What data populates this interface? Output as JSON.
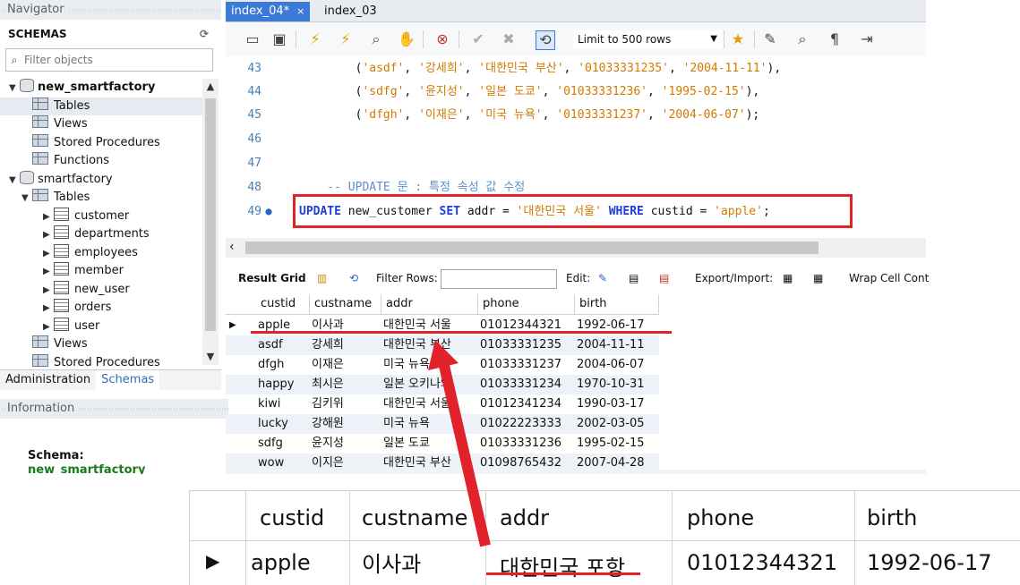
{
  "navigator": {
    "header": "Navigator",
    "schemas_label": "SCHEMAS",
    "filter_placeholder": "Filter objects",
    "tree": [
      {
        "label": "new_smartfactory",
        "kind": "schema",
        "bold": true
      },
      {
        "label": "Tables",
        "kind": "folder",
        "selected": true
      },
      {
        "label": "Views",
        "kind": "folder"
      },
      {
        "label": "Stored Procedures",
        "kind": "folder"
      },
      {
        "label": "Functions",
        "kind": "folder"
      },
      {
        "label": "smartfactory",
        "kind": "schema"
      },
      {
        "label": "Tables",
        "kind": "folder"
      },
      {
        "label": "customer",
        "kind": "table"
      },
      {
        "label": "departments",
        "kind": "table"
      },
      {
        "label": "employees",
        "kind": "table"
      },
      {
        "label": "member",
        "kind": "table"
      },
      {
        "label": "new_user",
        "kind": "table"
      },
      {
        "label": "orders",
        "kind": "table"
      },
      {
        "label": "user",
        "kind": "table"
      },
      {
        "label": "Views",
        "kind": "folder"
      },
      {
        "label": "Stored Procedures",
        "kind": "folder"
      }
    ],
    "tabs": [
      "Administration",
      "Schemas"
    ],
    "info_header": "Information",
    "schema_label": "Schema:",
    "schema_value": "new_smartfactory"
  },
  "editor": {
    "tabs": [
      {
        "label": "index_04*",
        "close": "×"
      },
      {
        "label": "index_03"
      }
    ],
    "limit_label": "Limit to 500 rows",
    "lines": [
      {
        "no": "43",
        "parts": [
          [
            "p",
            "        ("
          ],
          [
            "s",
            "'asdf'"
          ],
          [
            "p",
            ", "
          ],
          [
            "s",
            "'강세희'"
          ],
          [
            "p",
            ", "
          ],
          [
            "s",
            "'대한민국 부산'"
          ],
          [
            "p",
            ", "
          ],
          [
            "s",
            "'01033331235'"
          ],
          [
            "p",
            ", "
          ],
          [
            "s",
            "'2004-11-11'"
          ],
          [
            "p",
            "),"
          ]
        ]
      },
      {
        "no": "44",
        "parts": [
          [
            "p",
            "        ("
          ],
          [
            "s",
            "'sdfg'"
          ],
          [
            "p",
            ", "
          ],
          [
            "s",
            "'윤지성'"
          ],
          [
            "p",
            ", "
          ],
          [
            "s",
            "'일본 도쿄'"
          ],
          [
            "p",
            ", "
          ],
          [
            "s",
            "'01033331236'"
          ],
          [
            "p",
            ", "
          ],
          [
            "s",
            "'1995-02-15'"
          ],
          [
            "p",
            "),"
          ]
        ]
      },
      {
        "no": "45",
        "parts": [
          [
            "p",
            "        ("
          ],
          [
            "s",
            "'dfgh'"
          ],
          [
            "p",
            ", "
          ],
          [
            "s",
            "'이재은'"
          ],
          [
            "p",
            ", "
          ],
          [
            "s",
            "'미국 뉴욕'"
          ],
          [
            "p",
            ", "
          ],
          [
            "s",
            "'01033331237'"
          ],
          [
            "p",
            ", "
          ],
          [
            "s",
            "'2004-06-07'"
          ],
          [
            "p",
            ");"
          ]
        ]
      },
      {
        "no": "46",
        "parts": []
      },
      {
        "no": "47",
        "parts": []
      },
      {
        "no": "48",
        "parts": [
          [
            "c",
            "    -- UPDATE 문 : 특정 속성 값 수정"
          ]
        ]
      },
      {
        "no": "49",
        "dot": true,
        "parts": [
          [
            "k",
            "UPDATE"
          ],
          [
            "p",
            " new_customer "
          ],
          [
            "k",
            "SET"
          ],
          [
            "p",
            " addr = "
          ],
          [
            "s",
            "'대한민국 서울'"
          ],
          [
            "p",
            " "
          ],
          [
            "k",
            "WHERE"
          ],
          [
            "p",
            " custid = "
          ],
          [
            "s",
            "'apple'"
          ],
          [
            "p",
            ";"
          ]
        ]
      }
    ]
  },
  "result": {
    "result_grid_label": "Result Grid",
    "filter_rows_label": "Filter Rows:",
    "edit_label": "Edit:",
    "export_label": "Export/Import:",
    "wrap_label": "Wrap Cell Cont",
    "columns": [
      "custid",
      "custname",
      "addr",
      "phone",
      "birth"
    ],
    "rows": [
      [
        "apple",
        "이사과",
        "대한민국 서울",
        "01012344321",
        "1992-06-17"
      ],
      [
        "asdf",
        "강세희",
        "대한민국 부산",
        "01033331235",
        "2004-11-11"
      ],
      [
        "dfgh",
        "이재은",
        "미국 뉴욕",
        "01033331237",
        "2004-06-07"
      ],
      [
        "happy",
        "최시은",
        "일본 오키나와",
        "01033331234",
        "1970-10-31"
      ],
      [
        "kiwi",
        "김키위",
        "대한민국 서울",
        "01012341234",
        "1990-03-17"
      ],
      [
        "lucky",
        "강해원",
        "미국 뉴욕",
        "01022223333",
        "2002-03-05"
      ],
      [
        "sdfg",
        "윤지성",
        "일본 도쿄",
        "01033331236",
        "1995-02-15"
      ],
      [
        "wow",
        "이지은",
        "대한민국 부산",
        "01098765432",
        "2007-04-28"
      ]
    ]
  },
  "zoom": {
    "columns": [
      "custid",
      "custname",
      "addr",
      "phone",
      "birth"
    ],
    "row": [
      "apple",
      "이사과",
      "대한민국 포항",
      "01012344321",
      "1992-06-17"
    ]
  },
  "colors": {
    "annotation_red": "#e1222b",
    "active_tab": "#3b7ad6",
    "keyword": "#1f3fd6",
    "string": "#d07a00"
  }
}
